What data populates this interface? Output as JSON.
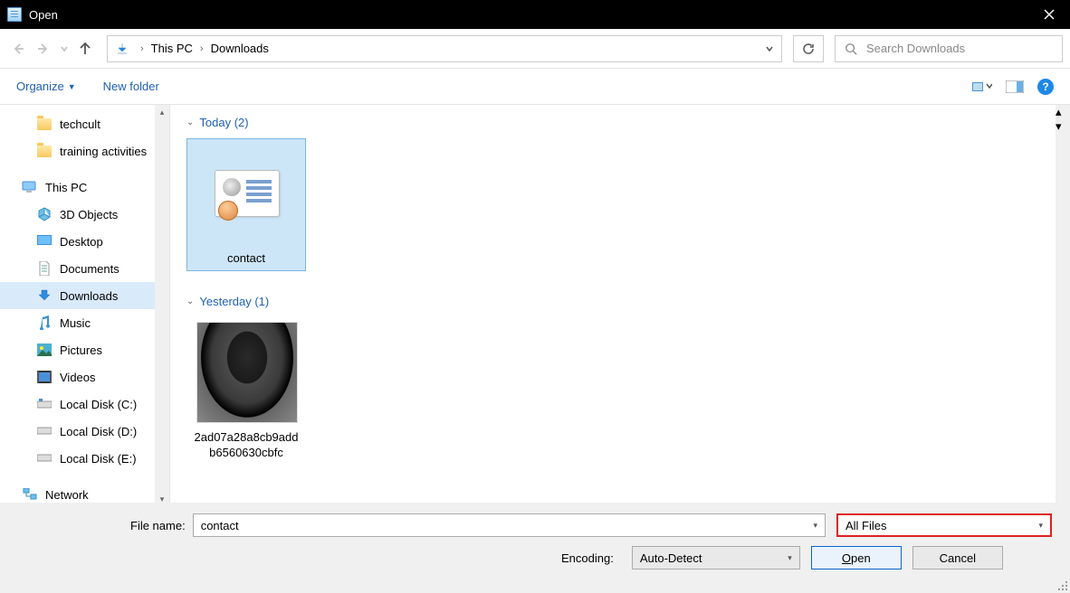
{
  "window": {
    "title": "Open"
  },
  "nav": {
    "breadcrumb": [
      "This PC",
      "Downloads"
    ],
    "search_placeholder": "Search Downloads"
  },
  "toolbar": {
    "organize": "Organize",
    "new_folder": "New folder"
  },
  "sidebar": {
    "quick": [
      {
        "label": "techcult"
      },
      {
        "label": "training activities"
      }
    ],
    "this_pc_label": "This PC",
    "this_pc": [
      {
        "label": "3D Objects",
        "icon": "3d"
      },
      {
        "label": "Desktop",
        "icon": "desktop"
      },
      {
        "label": "Documents",
        "icon": "documents"
      },
      {
        "label": "Downloads",
        "icon": "downloads",
        "selected": true
      },
      {
        "label": "Music",
        "icon": "music"
      },
      {
        "label": "Pictures",
        "icon": "pictures"
      },
      {
        "label": "Videos",
        "icon": "videos"
      },
      {
        "label": "Local Disk (C:)",
        "icon": "disk"
      },
      {
        "label": "Local Disk (D:)",
        "icon": "disk"
      },
      {
        "label": "Local Disk (E:)",
        "icon": "disk"
      }
    ],
    "network_label": "Network"
  },
  "content": {
    "groups": [
      {
        "header": "Today (2)",
        "items": [
          {
            "name": "contact",
            "type": "vcard",
            "selected": true
          }
        ]
      },
      {
        "header": "Yesterday (1)",
        "items": [
          {
            "name": "2ad07a28a8cb9addb6560630cbfc",
            "type": "image",
            "selected": false
          }
        ]
      }
    ]
  },
  "bottom": {
    "filename_label": "File name:",
    "filename_value": "contact",
    "filetype_value": "All Files",
    "encoding_label": "Encoding:",
    "encoding_value": "Auto-Detect",
    "open_label": "Open",
    "cancel_label": "Cancel"
  }
}
